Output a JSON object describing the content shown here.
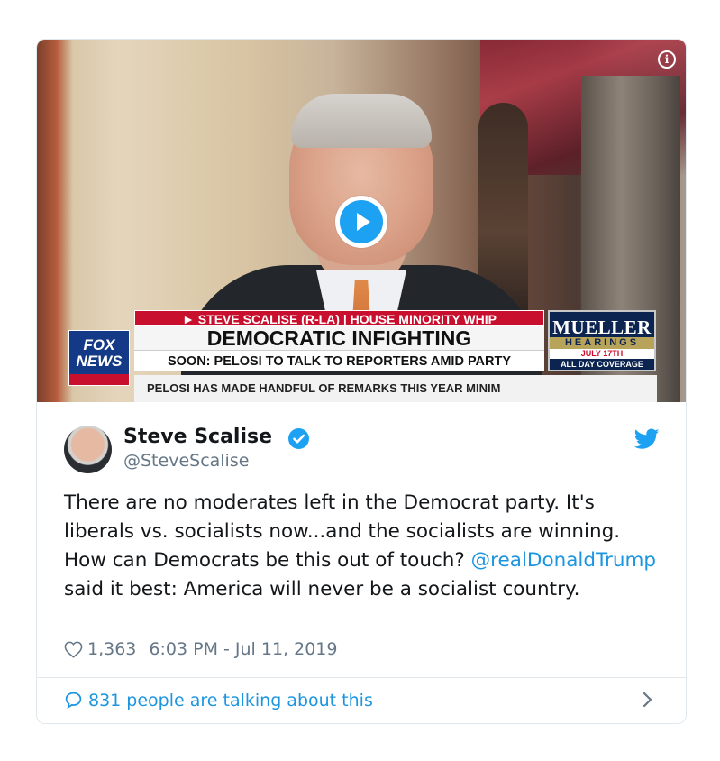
{
  "video": {
    "nameplate": "► STEVE SCALISE (R-LA) | HOUSE MINORITY WHIP",
    "headline": "DEMOCRATIC INFIGHTING",
    "subheadline": "SOON: PELOSI TO TALK TO REPORTERS AMID PARTY TENSIONS",
    "ticker": "PELOSI HAS MADE HANDFUL OF REMARKS THIS YEAR MINIM",
    "network_logo": "FOX NEWS",
    "promo": {
      "line1": "MUELLER",
      "line2": "HEARINGS",
      "line3": "JULY 17TH",
      "line4": "ALL DAY COVERAGE"
    },
    "play_icon": "play-icon",
    "info_icon": "info-icon"
  },
  "tweet": {
    "author_name": "Steve Scalise",
    "author_handle": "@SteveScalise",
    "text_before_mention": "There are no moderates left in the Democrat party. It's liberals vs. socialists now...and the socialists are winning. How can Democrats be this out of touch?",
    "mention": "@realDonaldTrump",
    "text_after_mention": " said it best: America will never be a socialist country.",
    "likes": "1,363",
    "timestamp": "6:03 PM - Jul 11, 2019",
    "talking": "831 people are talking about this"
  },
  "colors": {
    "twitter_blue": "#1da1f2",
    "link_blue": "#1b95e0",
    "muted_text": "#657786",
    "border": "#e1e8ed"
  }
}
